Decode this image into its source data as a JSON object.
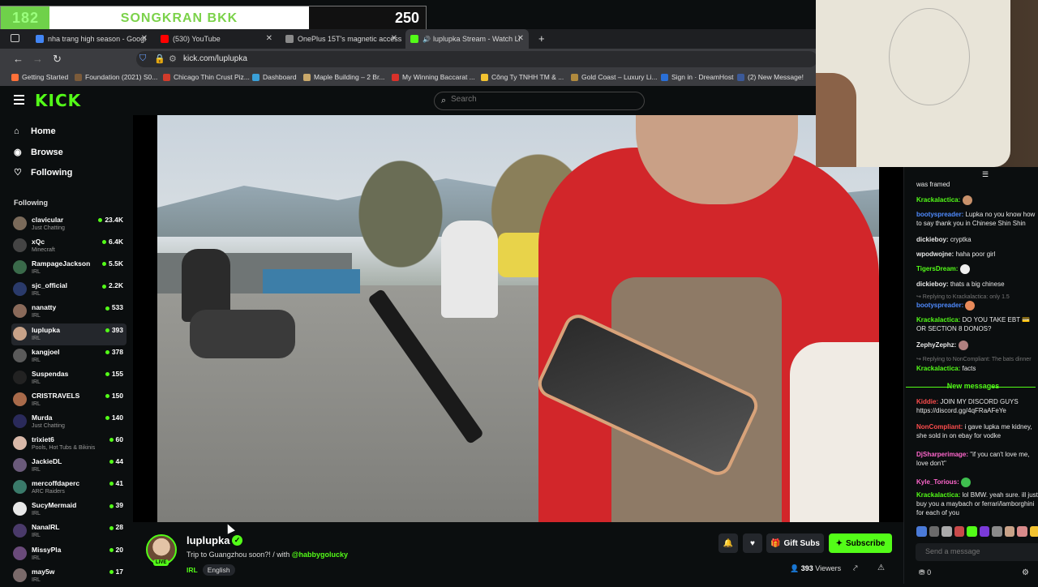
{
  "overlay": {
    "left_number": "182",
    "title": "SONGKRAN BKK",
    "right_number": "250"
  },
  "browser": {
    "tabs": [
      {
        "label": "nha trang high season - Googl",
        "color": "#4285f4"
      },
      {
        "label": "(530) YouTube",
        "color": "#ff0000"
      },
      {
        "label": "OnePlus 15T's magnetic access",
        "color": "#8a8a8a"
      },
      {
        "label": "luplupka Stream - Watch Li",
        "color": "#53fc18"
      }
    ],
    "new_tab": "+",
    "url": "kick.com/luplupka",
    "bookmarks": [
      {
        "label": "Getting Started",
        "color": "#ff7139"
      },
      {
        "label": "Foundation (2021) S0...",
        "color": "#7b5b3a"
      },
      {
        "label": "Chicago Thin Crust Piz...",
        "color": "#d23b2b"
      },
      {
        "label": "Dashboard",
        "color": "#3aa0d8"
      },
      {
        "label": "Maple Building – 2 Br...",
        "color": "#c9a86a"
      },
      {
        "label": "My Winning Baccarat ...",
        "color": "#d8312a"
      },
      {
        "label": "Công Ty TNHH TM & ...",
        "color": "#f2c230"
      },
      {
        "label": "Gold Coast – Luxury Li...",
        "color": "#b08a3e"
      },
      {
        "label": "Sign in · DreamHost",
        "color": "#2a6fd6"
      },
      {
        "label": "(2) New Message!",
        "color": "#3b5998"
      }
    ]
  },
  "kick": {
    "logo": "KICK",
    "search_placeholder": "Search"
  },
  "sidebar": {
    "nav": [
      {
        "label": "Home",
        "icon": "⌂"
      },
      {
        "label": "Browse",
        "icon": "◉"
      },
      {
        "label": "Following",
        "icon": "♡"
      }
    ],
    "following_title": "Following",
    "channels": [
      {
        "name": "clavicular",
        "category": "Just Chatting",
        "viewers": "23.4K",
        "color": "#7a6a5a"
      },
      {
        "name": "xQc",
        "category": "Minecraft",
        "viewers": "6.4K",
        "color": "#444"
      },
      {
        "name": "RampageJackson",
        "category": "IRL",
        "viewers": "5.5K",
        "color": "#3a6a4a"
      },
      {
        "name": "sjc_official",
        "category": "IRL",
        "viewers": "2.2K",
        "color": "#2a3a6a"
      },
      {
        "name": "nanatty",
        "category": "IRL",
        "viewers": "533",
        "color": "#8a6a5a"
      },
      {
        "name": "luplupka",
        "category": "IRL",
        "viewers": "393",
        "color": "#c8a288"
      },
      {
        "name": "kangjoel",
        "category": "IRL",
        "viewers": "378",
        "color": "#5a5a5a"
      },
      {
        "name": "Suspendas",
        "category": "IRL",
        "viewers": "155",
        "color": "#222"
      },
      {
        "name": "CRISTRAVELS",
        "category": "IRL",
        "viewers": "150",
        "color": "#a86a4a"
      },
      {
        "name": "Murda",
        "category": "Just Chatting",
        "viewers": "140",
        "color": "#2a2a5a"
      },
      {
        "name": "trixiet6",
        "category": "Pools, Hot Tubs & Bikinis",
        "viewers": "60",
        "color": "#d8b8a8"
      },
      {
        "name": "JackieDL",
        "category": "IRL",
        "viewers": "44",
        "color": "#6a5a7a"
      },
      {
        "name": "mercoffdaperc",
        "category": "ARC Raiders",
        "viewers": "41",
        "color": "#3a7a6a"
      },
      {
        "name": "SucyMermaid",
        "category": "IRL",
        "viewers": "39",
        "color": "#e8e8e8"
      },
      {
        "name": "NanalRL",
        "category": "IRL",
        "viewers": "28",
        "color": "#4a3a6a"
      },
      {
        "name": "MissyPla",
        "category": "IRL",
        "viewers": "20",
        "color": "#6a4a7a"
      },
      {
        "name": "may5w",
        "category": "IRL",
        "viewers": "17",
        "color": "#7a6a6a"
      }
    ]
  },
  "chat": {
    "messages": [
      {
        "user": "",
        "text": "was framed",
        "color": "#e8e8e8"
      },
      {
        "user": "Krackalactica:",
        "text": "",
        "color": "#53fc18",
        "emote": "#c9916b"
      },
      {
        "user": "bootyspreader:",
        "text": "Lupka no you know how to say thank you in Chinese Shin Shin",
        "color": "#4f8bff"
      },
      {
        "user": "dickieboy:",
        "text": "cryptka",
        "color": "#e8e8e8"
      },
      {
        "user": "wpodwojne:",
        "text": "haha poor girl",
        "color": "#e8e8e8"
      },
      {
        "user": "TigersDream:",
        "text": "",
        "color": "#53fc18",
        "emote": "#f0f0f0"
      },
      {
        "user": "dickieboy:",
        "text": "thats a big chinese",
        "color": "#e8e8e8"
      },
      {
        "user": "",
        "text": "↪ Replying to Krackalactica: only 1.5",
        "color": "#777",
        "reply": true
      },
      {
        "user": "bootyspreader:",
        "text": "",
        "color": "#4f8bff",
        "emote": "#e88a5a"
      },
      {
        "user": "Krackalactica:",
        "text": "DO YOU TAKE EBT 💳 OR SECTION 8 DONOS?",
        "color": "#53fc18"
      },
      {
        "user": "ZephyZephz:",
        "text": "",
        "color": "#e8e8e8",
        "emote": "#b08080"
      },
      {
        "user": "",
        "text": "↪ Replying to NonCompliant: The bats dinner",
        "color": "#777",
        "reply": true
      },
      {
        "user": "Krackalactica:",
        "text": "facts",
        "color": "#53fc18"
      }
    ],
    "new_messages_label": "New messages",
    "new": [
      {
        "user": "Kiddie:",
        "text": "JOIN MY DISCORD GUYS https://discord.gg/4qFRaAFeYe",
        "color": "#ff4d4d"
      },
      {
        "user": "NonCompliant:",
        "text": "i gave lupka me kidney, she sold in on ebay for vodke",
        "color": "#ff4d4d"
      },
      {
        "user": "DjSharperimage:",
        "text": "\"if you can't love me, love don't\"",
        "color": "#ff66cc"
      },
      {
        "user": "Kyle_Torious:",
        "text": "",
        "color": "#ff66cc",
        "emote": "#3fbf4f"
      },
      {
        "user": "Krackalactica:",
        "text": "lol BMW. yeah sure. ill just buy you a maybach or ferrari/lamborghini for each of you",
        "color": "#53fc18"
      }
    ],
    "emotes": [
      "#4a7ad8",
      "#6a6a6a",
      "#aaa",
      "#c84a4a",
      "#53fc18",
      "#7a3ad8",
      "#8a8a8a",
      "#c8a288",
      "#d88a8a",
      "#f2c230"
    ],
    "send_placeholder": "Send a message",
    "footer_count": "0"
  },
  "stream": {
    "name": "luplupka",
    "live_label": "LIVE",
    "title": "Trip to Guangzhou soon?! / with ",
    "mention": "@habbygolucky",
    "category": "IRL",
    "language": "English",
    "gift_label": "Gift Subs",
    "subscribe_label": "Subscribe",
    "viewers": "393",
    "viewers_label": "Viewers"
  }
}
